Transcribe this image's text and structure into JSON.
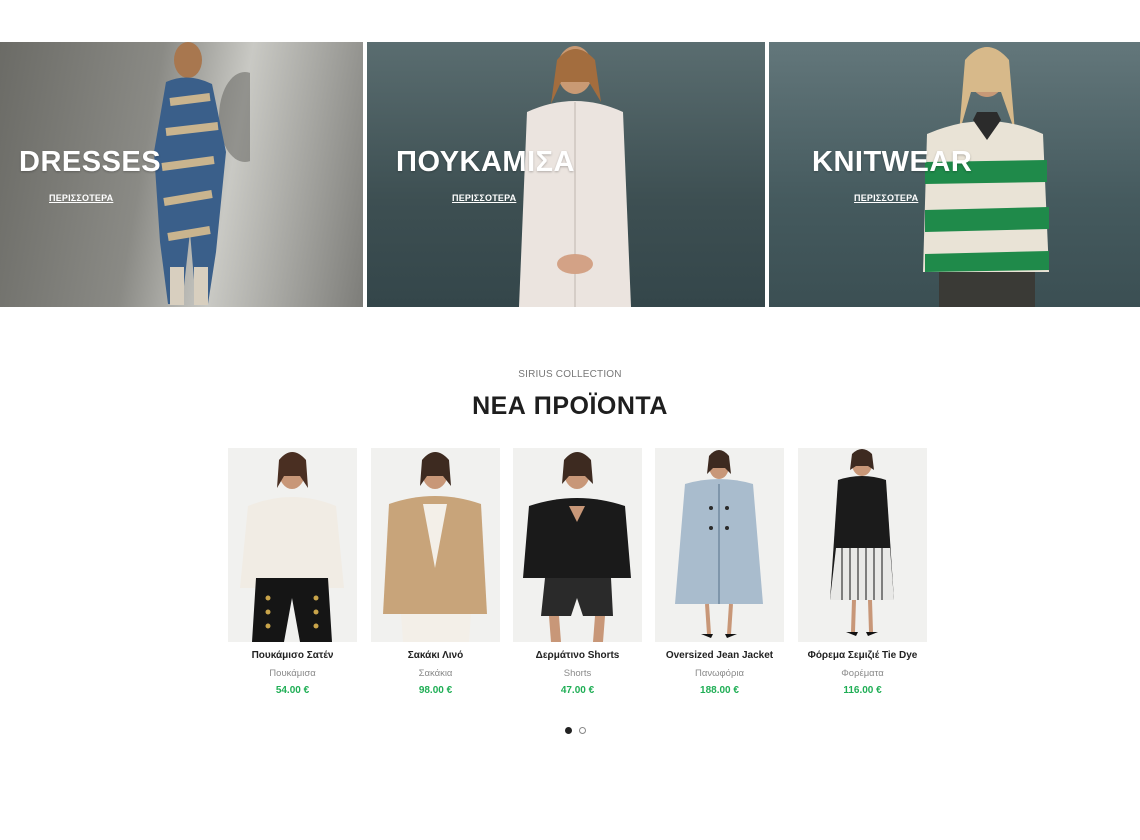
{
  "banners": [
    {
      "title": "DRESSES",
      "link": "ΠΕΡΙΣΣΟΤΕΡΑ"
    },
    {
      "title": "ΠΟΥΚΑΜΙΣΑ",
      "link": "ΠΕΡΙΣΣΟΤΕΡΑ"
    },
    {
      "title": "KNITWEAR",
      "link": "ΠΕΡΙΣΣΟΤΕΡΑ"
    }
  ],
  "section": {
    "eyebrow": "SIRIUS COLLECTION",
    "title": "ΝΕΑ ΠΡΟΪΟΝΤΑ"
  },
  "products": [
    {
      "name": "Πουκάμισο Σατέν",
      "category": "Πουκάμισα",
      "price": "54.00 €"
    },
    {
      "name": "Σακάκι Λινό",
      "category": "Σακάκια",
      "price": "98.00 €"
    },
    {
      "name": "Δερμάτινο Shorts",
      "category": "Shorts",
      "price": "47.00 €"
    },
    {
      "name": "Oversized Jean Jacket",
      "category": "Πανωφόρια",
      "price": "188.00 €"
    },
    {
      "name": "Φόρεμα Σεμιζιέ Tie Dye",
      "category": "Φορέματα",
      "price": "116.00 €"
    }
  ],
  "carousel": {
    "pages": 2,
    "active": 1
  },
  "colors": {
    "price": "#1fae55",
    "title": "#1e1e1e",
    "banner_text": "#ffffff"
  }
}
